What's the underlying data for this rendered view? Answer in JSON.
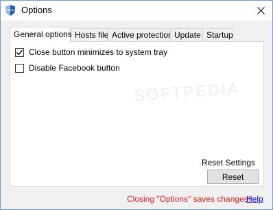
{
  "window": {
    "title": "Options",
    "icon": "shield-icon",
    "close_icon": "close-icon"
  },
  "tabs": [
    {
      "label": "General options",
      "active": true
    },
    {
      "label": "Hosts file",
      "active": false
    },
    {
      "label": "Active protection",
      "active": false
    },
    {
      "label": "Update",
      "active": false
    },
    {
      "label": "Startup",
      "active": false
    }
  ],
  "general": {
    "options": [
      {
        "label": "Close button minimizes to system tray",
        "checked": true
      },
      {
        "label": "Disable Facebook button",
        "checked": false
      }
    ],
    "reset_label": "Reset Settings",
    "reset_button": "Reset"
  },
  "footer": {
    "note": "Closing \"Options\" saves changes!",
    "help": "Help"
  },
  "colors": {
    "footer_note": "#e02020",
    "link": "#0000ee",
    "border": "#6b9bd1"
  }
}
